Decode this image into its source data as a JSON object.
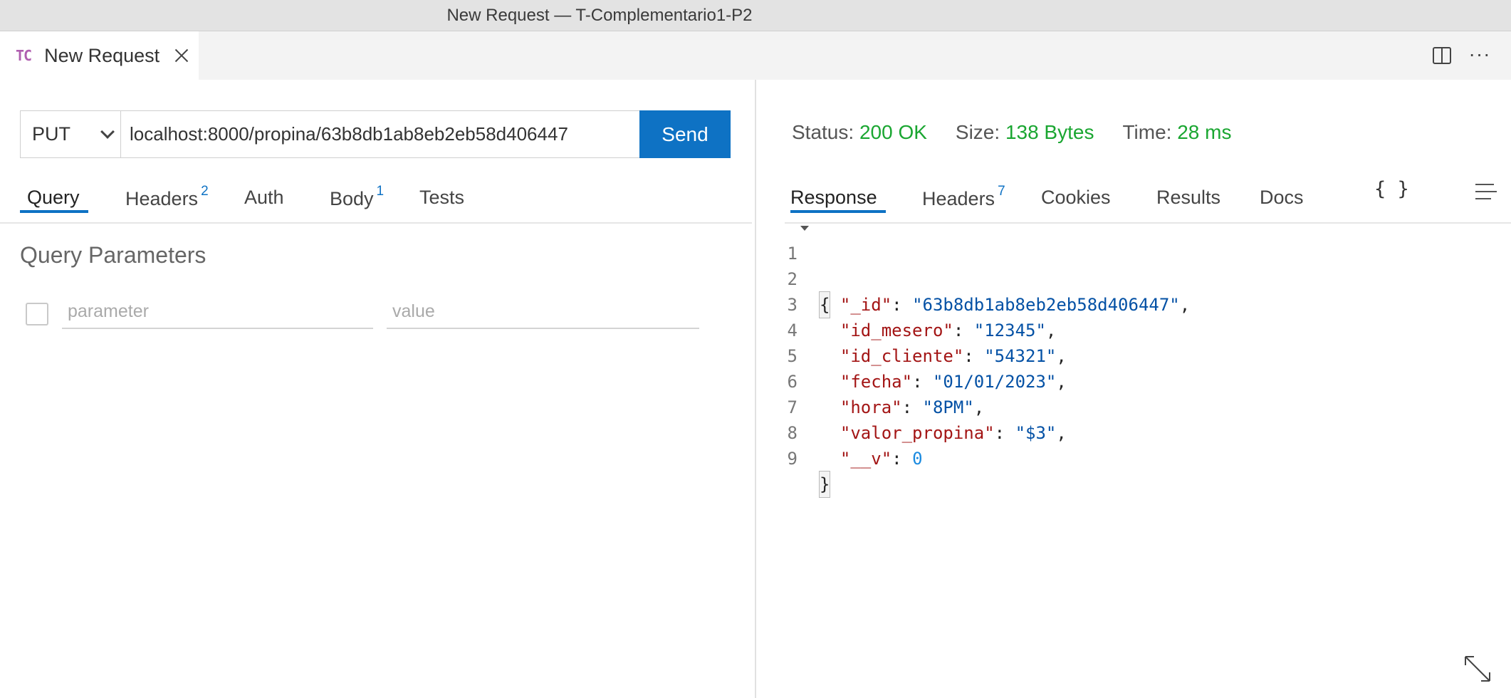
{
  "window": {
    "title": "New Request — T-Complementario1-P2"
  },
  "tab": {
    "icon": "TC",
    "label": "New Request"
  },
  "request": {
    "method": "PUT",
    "url": "localhost:8000/propina/63b8db1ab8eb2eb58d406447",
    "send_label": "Send",
    "tabs": [
      {
        "label": "Query",
        "badge": ""
      },
      {
        "label": "Headers",
        "badge": "2"
      },
      {
        "label": "Auth",
        "badge": ""
      },
      {
        "label": "Body",
        "badge": "1"
      },
      {
        "label": "Tests",
        "badge": ""
      }
    ],
    "active_tab": "Query",
    "query": {
      "heading": "Query Parameters",
      "param_placeholder": "parameter",
      "value_placeholder": "value"
    }
  },
  "response": {
    "status_label": "Status:",
    "status_value": "200 OK",
    "size_label": "Size:",
    "size_value": "138 Bytes",
    "time_label": "Time:",
    "time_value": "28 ms",
    "tabs": [
      {
        "label": "Response",
        "badge": ""
      },
      {
        "label": "Headers",
        "badge": "7"
      },
      {
        "label": "Cookies",
        "badge": ""
      },
      {
        "label": "Results",
        "badge": ""
      },
      {
        "label": "Docs",
        "badge": ""
      }
    ],
    "active_tab": "Response",
    "body": [
      {
        "num": "1",
        "text": "{"
      },
      {
        "num": "2",
        "key": "\"_id\"",
        "value": "\"63b8db1ab8eb2eb58d406447\"",
        "type": "string",
        "comma": true
      },
      {
        "num": "3",
        "key": "\"id_mesero\"",
        "value": "\"12345\"",
        "type": "string",
        "comma": true
      },
      {
        "num": "4",
        "key": "\"id_cliente\"",
        "value": "\"54321\"",
        "type": "string",
        "comma": true
      },
      {
        "num": "5",
        "key": "\"fecha\"",
        "value": "\"01/01/2023\"",
        "type": "string",
        "comma": true
      },
      {
        "num": "6",
        "key": "\"hora\"",
        "value": "\"8PM\"",
        "type": "string",
        "comma": true
      },
      {
        "num": "7",
        "key": "\"valor_propina\"",
        "value": "\"$3\"",
        "type": "string",
        "comma": true
      },
      {
        "num": "8",
        "key": "\"__v\"",
        "value": "0",
        "type": "number",
        "comma": false
      },
      {
        "num": "9",
        "text": "}"
      }
    ]
  },
  "colors": {
    "accent": "#0e72c4",
    "status_ok": "#1aa631",
    "json_key": "#a31515",
    "json_string": "#0451a5",
    "json_number": "#1a8ae0"
  },
  "icons": {
    "tab_close": "close-icon",
    "split": "split-editor-icon",
    "more": "more-actions-icon",
    "method_dropdown": "chevron-down-icon",
    "format": "braces-icon",
    "wrap": "lines-icon",
    "fold": "fold-arrow-icon",
    "expand": "expand-icon"
  }
}
